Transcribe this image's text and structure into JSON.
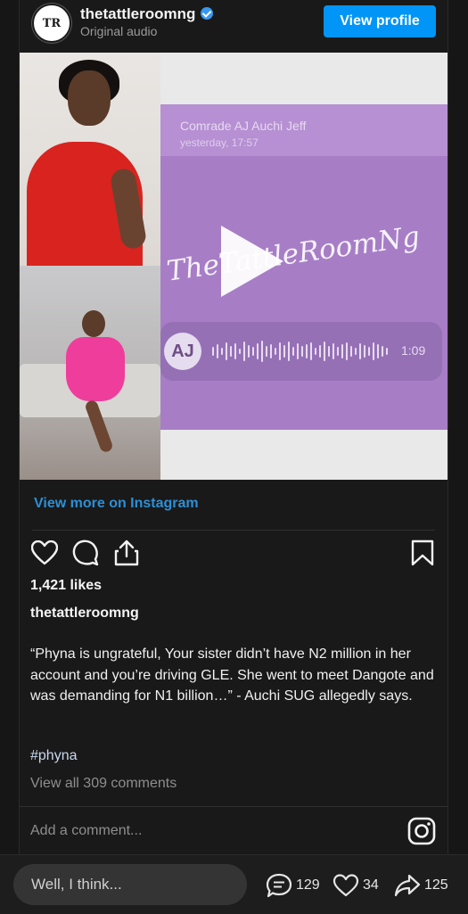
{
  "post": {
    "username": "thetattleroomng",
    "subtitle": "Original audio",
    "avatar_text": "TR",
    "view_profile_label": "View profile",
    "media": {
      "audio_sender": "Comrade AJ Auchi Jeff",
      "audio_time": "yesterday, 17:57",
      "watermark": "TheTattleRoomNg",
      "voice_avatar": "AJ",
      "duration": "1:09"
    },
    "view_more_label": "View more on Instagram",
    "likes": "1,421 likes",
    "caption_user": "thetattleroomng",
    "caption": "“Phyna is ungrateful, Your sister didn’t have N2 million in her account and you’re driving GLE. She went to meet Dangote and was demanding for N1 billion…” - Auchi SUG allegedly says.",
    "hashtag": "#phyna",
    "view_comments": "View all 309 comments",
    "add_comment_placeholder": "Add a comment..."
  },
  "bottom_bar": {
    "comment_placeholder": "Well, I think...",
    "comments_count": "129",
    "likes_count": "34",
    "shares_count": "125"
  },
  "icons": {
    "like": "heart-icon",
    "comment": "comment-icon",
    "share": "share-icon",
    "save": "bookmark-icon",
    "instagram": "instagram-icon"
  },
  "colors": {
    "accent": "#0095f6",
    "link": "#2d8fd5",
    "background": "#161616",
    "audio_panel": "#a77ec6"
  }
}
